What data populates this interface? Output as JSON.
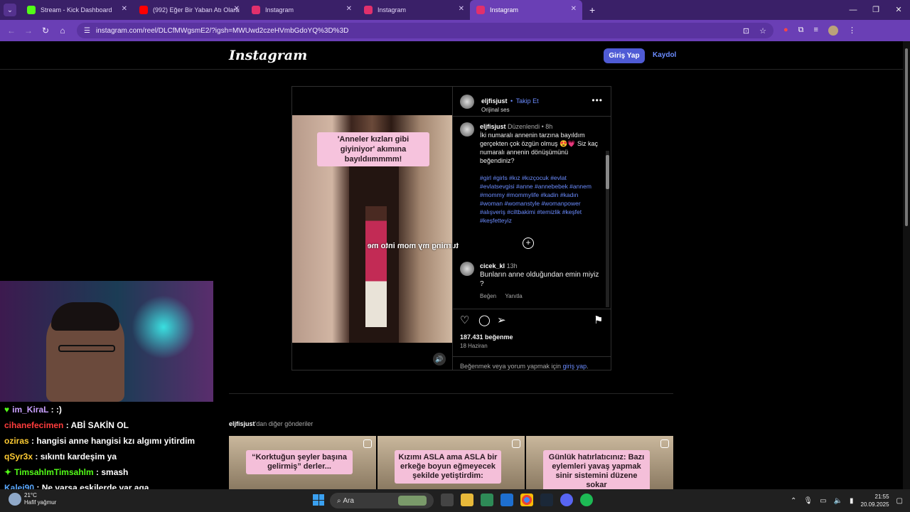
{
  "browser": {
    "tabs": [
      {
        "label": "Stream - Kick Dashboard",
        "favicon_color": "#53fc18",
        "active": false
      },
      {
        "label": "(992) Eğer Bir Yaban Atı Olarak",
        "favicon_color": "#ff0000",
        "active": false
      },
      {
        "label": "Instagram",
        "favicon_color": "#e1306c",
        "active": false
      },
      {
        "label": "Instagram",
        "favicon_color": "#e1306c",
        "active": false
      },
      {
        "label": "Instagram",
        "favicon_color": "#e1306c",
        "active": true
      }
    ],
    "new_tab": "+",
    "url": "instagram.com/reel/DLCfMWgsmE2/?igsh=MWUwd2czeHVmbGdoYQ%3D%3D"
  },
  "instagram": {
    "logo": "Instagram",
    "login_button": "Giriş Yap",
    "signup_link": "Kaydol",
    "post": {
      "username": "eljfisjust",
      "follow_sep": "•",
      "follow": "Takip Et",
      "audio": "Orijinal ses",
      "video_caption": "'Anneler kızları gibi giyiniyor' akımına bayıldıımmmm!",
      "video_overlay_text": "turning my mom into me",
      "caption": {
        "username": "eljfisjust",
        "edited": "Düzenlendi • 8h",
        "text": "İki numaralı annenin tarzına bayıldım gerçekten çok özgün olmuş 😍💗 Siz kaç numaralı annenin dönüşümünü beğendiniz?",
        "hashtags": "#girl #girls #kız #kızçocuk #evlat #evlatsevgisi #anne #annebebek #annem #mommy #mommylife #kadin #kadın #woman #womanstyle #womanpower #alışveriş #ciltbakimi #temizlik #keşfet #keşfetteyiz"
      },
      "comment": {
        "username": "cicek_kl",
        "time": "13h",
        "text": "Bunların anne olduğundan emin miyiz ?",
        "like": "Beğen",
        "reply": "Yanıtla"
      },
      "likes": "187.431 beğenme",
      "date": "18 Haziran",
      "login_hint_prefix": "Beğenmek veya yorum yapmak için ",
      "login_hint_link": "giriş yap",
      "login_hint_suffix": "."
    },
    "more_posts": {
      "username": "eljfisjust",
      "suffix": "'dan diğer gönderiler",
      "items": [
        {
          "caption": "“Korktuğun şeyler başına gelirmiş” derler..."
        },
        {
          "caption": "Kızımı ASLA ama ASLA bir erkeğe boyun eğmeyecek şekilde yetiştirdim:"
        },
        {
          "caption": "Günlük hatırlatıcınız: Bazı eylemleri yavaş yapmak sinir sistemini düzene sokar"
        }
      ]
    }
  },
  "chat": [
    {
      "user": "im_KiraL",
      "color": "#c9a0ff",
      "msg": ":)",
      "badge": "♥"
    },
    {
      "user": "cihanefecimen",
      "color": "#ff3c3c",
      "msg": "ABİ SAKİN OL"
    },
    {
      "user": "oziras",
      "color": "#ffcc33",
      "msg": "hangisi anne hangisi kzı algımı yitirdim"
    },
    {
      "user": "qSyr3x",
      "color": "#ffcc33",
      "msg": "sıkıntı kardeşim ya"
    },
    {
      "user": "TimsahlmTimsahlm",
      "color": "#53fc18",
      "msg": "smash",
      "badge": "✦"
    },
    {
      "user": "Kalei90",
      "color": "#5aa8ff",
      "msg": "Ne varsa eskilerde var aga"
    }
  ],
  "taskbar": {
    "weather_temp": "21°C",
    "weather_desc": "Hafif yağmur",
    "search_placeholder": "Ara",
    "time": "21:55",
    "date": "20.09.2025"
  }
}
